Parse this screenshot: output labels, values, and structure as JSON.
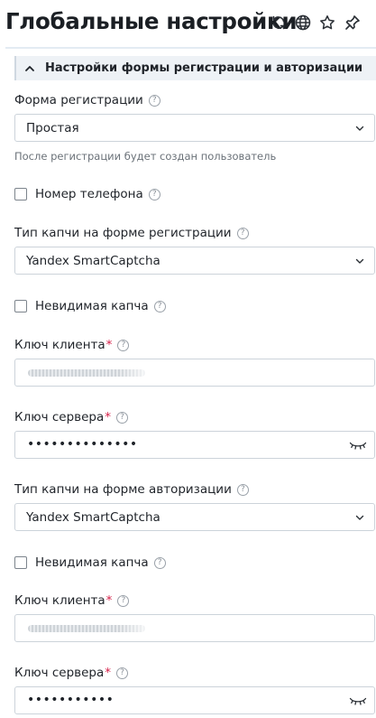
{
  "header": {
    "title": "Глобальные настройки",
    "icons": [
      "refresh-icon",
      "globe-icon",
      "star-icon",
      "pin-icon"
    ]
  },
  "section": {
    "title": "Настройки формы регистрации и авторизации",
    "expanded": true
  },
  "fields": {
    "reg_form_label": "Форма регистрации",
    "reg_form_value": "Простая",
    "reg_form_hint": "После регистрации будет создан пользователь",
    "phone_label": "Номер телефона",
    "reg_captcha_label": "Тип капчи на форме регистрации",
    "reg_captcha_value": "Yandex SmartCaptcha",
    "reg_invisible_label": "Невидимая капча",
    "reg_client_key_label": "Ключ клиента",
    "reg_server_key_label": "Ключ сервера",
    "reg_server_key_value": "••••••••••••••",
    "auth_captcha_label": "Тип капчи на форме авторизации",
    "auth_captcha_value": "Yandex SmartCaptcha",
    "auth_invisible_label": "Невидимая капча",
    "auth_client_key_label": "Ключ клиента",
    "auth_server_key_label": "Ключ сервера",
    "auth_server_key_value": "•••••••••••",
    "required_mark": "*",
    "help_glyph": "?"
  },
  "colors": {
    "required": "#d6224a",
    "border": "#ccd3da",
    "section_bg": "#eef2f6"
  }
}
